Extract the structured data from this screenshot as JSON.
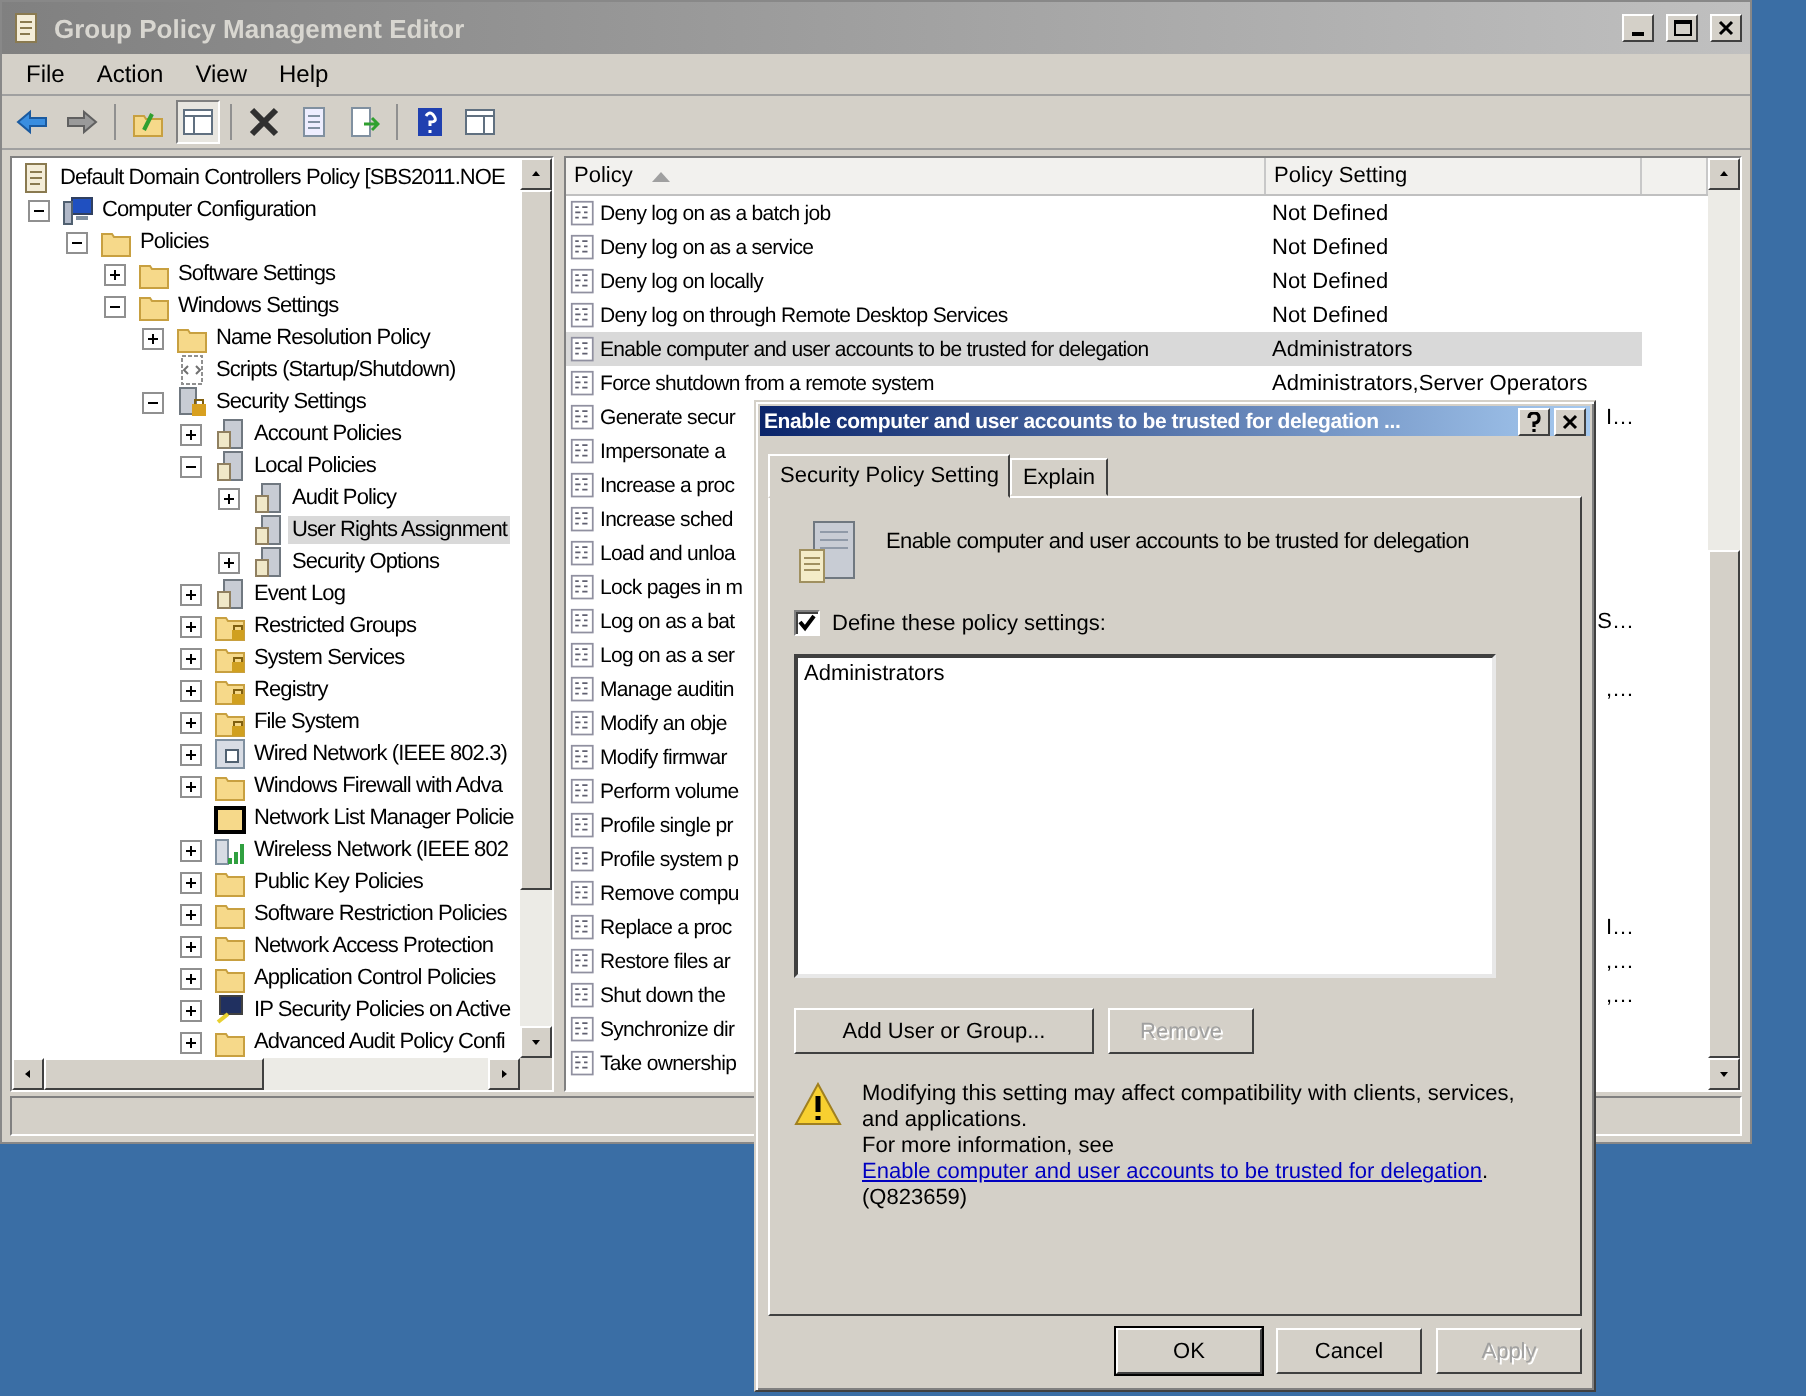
{
  "window": {
    "title": "Group Policy Management Editor"
  },
  "menu": [
    "File",
    "Action",
    "View",
    "Help"
  ],
  "toolbar": [
    {
      "kind": "back",
      "pressed": false
    },
    {
      "kind": "forward",
      "pressed": false
    },
    {
      "kind": "sep"
    },
    {
      "kind": "up",
      "pressed": false
    },
    {
      "kind": "tree",
      "pressed": true
    },
    {
      "kind": "sep"
    },
    {
      "kind": "delete",
      "pressed": false
    },
    {
      "kind": "properties",
      "pressed": false
    },
    {
      "kind": "export",
      "pressed": false
    },
    {
      "kind": "sep"
    },
    {
      "kind": "help",
      "pressed": false
    },
    {
      "kind": "action-pane",
      "pressed": false
    }
  ],
  "tree": {
    "label": "Default Domain Controllers Policy [SBS2011.NOE",
    "kind": "policy-doc",
    "selected": false,
    "children": [
      {
        "label": "Computer Configuration",
        "kind": "computer",
        "selected": false,
        "expanded": true,
        "children": [
          {
            "label": "Policies",
            "kind": "folder",
            "selected": false,
            "expanded": true,
            "children": [
              {
                "label": "Software Settings",
                "kind": "folder",
                "selected": false,
                "expanded": false
              },
              {
                "label": "Windows Settings",
                "kind": "folder",
                "selected": false,
                "expanded": true,
                "children": [
                  {
                    "label": "Name Resolution Policy",
                    "kind": "folder",
                    "selected": false,
                    "expanded": false
                  },
                  {
                    "label": "Scripts (Startup/Shutdown)",
                    "kind": "script",
                    "selected": false
                  },
                  {
                    "label": "Security Settings",
                    "kind": "security",
                    "selected": false,
                    "expanded": true,
                    "children": [
                      {
                        "label": "Account Policies",
                        "kind": "server",
                        "selected": false,
                        "expanded": false
                      },
                      {
                        "label": "Local Policies",
                        "kind": "server",
                        "selected": false,
                        "expanded": true,
                        "children": [
                          {
                            "label": "Audit Policy",
                            "kind": "server",
                            "selected": false,
                            "expanded": false
                          },
                          {
                            "label": "User Rights Assignment",
                            "kind": "server",
                            "selected": true
                          },
                          {
                            "label": "Security Options",
                            "kind": "server",
                            "selected": false,
                            "expanded": false
                          }
                        ]
                      },
                      {
                        "label": "Event Log",
                        "kind": "server",
                        "selected": false,
                        "expanded": false
                      },
                      {
                        "label": "Restricted Groups",
                        "kind": "lock-folder",
                        "selected": false,
                        "expanded": false
                      },
                      {
                        "label": "System Services",
                        "kind": "lock-folder",
                        "selected": false,
                        "expanded": false
                      },
                      {
                        "label": "Registry",
                        "kind": "lock-folder",
                        "selected": false,
                        "expanded": false
                      },
                      {
                        "label": "File System",
                        "kind": "lock-folder",
                        "selected": false,
                        "expanded": false
                      },
                      {
                        "label": "Wired Network (IEEE 802.3)",
                        "kind": "network",
                        "selected": false,
                        "expanded": false
                      },
                      {
                        "label": "Windows Firewall with Adva",
                        "kind": "folder",
                        "selected": false,
                        "expanded": false
                      },
                      {
                        "label": "Network List Manager Policie",
                        "kind": "dark-folder",
                        "selected": false
                      },
                      {
                        "label": "Wireless Network (IEEE 802",
                        "kind": "wireless",
                        "selected": false,
                        "expanded": false
                      },
                      {
                        "label": "Public Key Policies",
                        "kind": "folder",
                        "selected": false,
                        "expanded": false
                      },
                      {
                        "label": "Software Restriction Policies",
                        "kind": "folder",
                        "selected": false,
                        "expanded": false
                      },
                      {
                        "label": "Network Access Protection",
                        "kind": "folder",
                        "selected": false,
                        "expanded": false
                      },
                      {
                        "label": "Application Control Policies",
                        "kind": "folder",
                        "selected": false,
                        "expanded": false
                      },
                      {
                        "label": "IP Security Policies on Active",
                        "kind": "ipsec",
                        "selected": false,
                        "expanded": false
                      },
                      {
                        "label": "Advanced Audit Policy Confi",
                        "kind": "folder",
                        "selected": false,
                        "expanded": false
                      }
                    ]
                  }
                ]
              }
            ]
          }
        ]
      }
    ]
  },
  "policy_list": {
    "columns": [
      "Policy",
      "Policy Setting"
    ],
    "rows": [
      {
        "policy": "Deny log on as a batch job",
        "setting": "Not Defined",
        "selected": false
      },
      {
        "policy": "Deny log on as a service",
        "setting": "Not Defined",
        "selected": false
      },
      {
        "policy": "Deny log on locally",
        "setting": "Not Defined",
        "selected": false
      },
      {
        "policy": "Deny log on through Remote Desktop Services",
        "setting": "Not Defined",
        "selected": false
      },
      {
        "policy": "Enable computer and user accounts to be trusted for delegation",
        "setting": "Administrators",
        "selected": true
      },
      {
        "policy": "Force shutdown from a remote system",
        "setting": "Administrators,Server Operators",
        "selected": false
      },
      {
        "policy": "Generate secur",
        "setting": "I…",
        "setting_cut": true,
        "selected": false
      },
      {
        "policy": "Impersonate a",
        "selected": false
      },
      {
        "policy": "Increase a proc",
        "selected": false
      },
      {
        "policy": "Increase sched",
        "selected": false
      },
      {
        "policy": "Load and unloa",
        "selected": false
      },
      {
        "policy": "Lock pages in m",
        "selected": false
      },
      {
        "policy": "Log on as a bat",
        "setting": "S…",
        "setting_cut": true,
        "selected": false
      },
      {
        "policy": "Log on as a ser",
        "selected": false
      },
      {
        "policy": "Manage auditin",
        "setting": ",…",
        "setting_cut": true,
        "selected": false
      },
      {
        "policy": "Modify an obje",
        "selected": false
      },
      {
        "policy": "Modify firmwar",
        "selected": false
      },
      {
        "policy": "Perform volume",
        "selected": false
      },
      {
        "policy": "Profile single pr",
        "selected": false
      },
      {
        "policy": "Profile system p",
        "selected": false
      },
      {
        "policy": "Remove compu",
        "selected": false
      },
      {
        "policy": "Replace a proc",
        "setting": "I…",
        "setting_cut": true,
        "selected": false
      },
      {
        "policy": "Restore files ar",
        "setting": ",…",
        "setting_cut": true,
        "selected": false
      },
      {
        "policy": "Shut down the",
        "setting": ",…",
        "setting_cut": true,
        "selected": false
      },
      {
        "policy": "Synchronize dir",
        "selected": false
      },
      {
        "policy": "Take ownership",
        "selected": false
      }
    ]
  },
  "dialog": {
    "title": "Enable computer and user accounts to be trusted for delegation ...",
    "tabs": [
      {
        "label": "Security Policy Setting",
        "selected": true
      },
      {
        "label": "Explain",
        "selected": false
      }
    ],
    "policy_name": "Enable computer and user accounts to be trusted for delegation",
    "define": {
      "label": "Define these policy settings:",
      "checked": true
    },
    "members": [
      "Administrators"
    ],
    "buttons": [
      {
        "label": "Add User or Group...",
        "disabled": false
      },
      {
        "label": "Remove",
        "disabled": true
      }
    ],
    "warning": "Modifying this setting may affect compatibility with clients, services, and applications.",
    "more_info": {
      "prefix": "For more information, see",
      "link": "Enable computer and user accounts to be trusted for delegation",
      "suffix": ". (Q823659)"
    },
    "footer_buttons": [
      {
        "label": "OK",
        "default": true,
        "disabled": false
      },
      {
        "label": "Cancel",
        "default": false,
        "disabled": false
      },
      {
        "label": "Apply",
        "default": false,
        "disabled": true
      }
    ]
  }
}
